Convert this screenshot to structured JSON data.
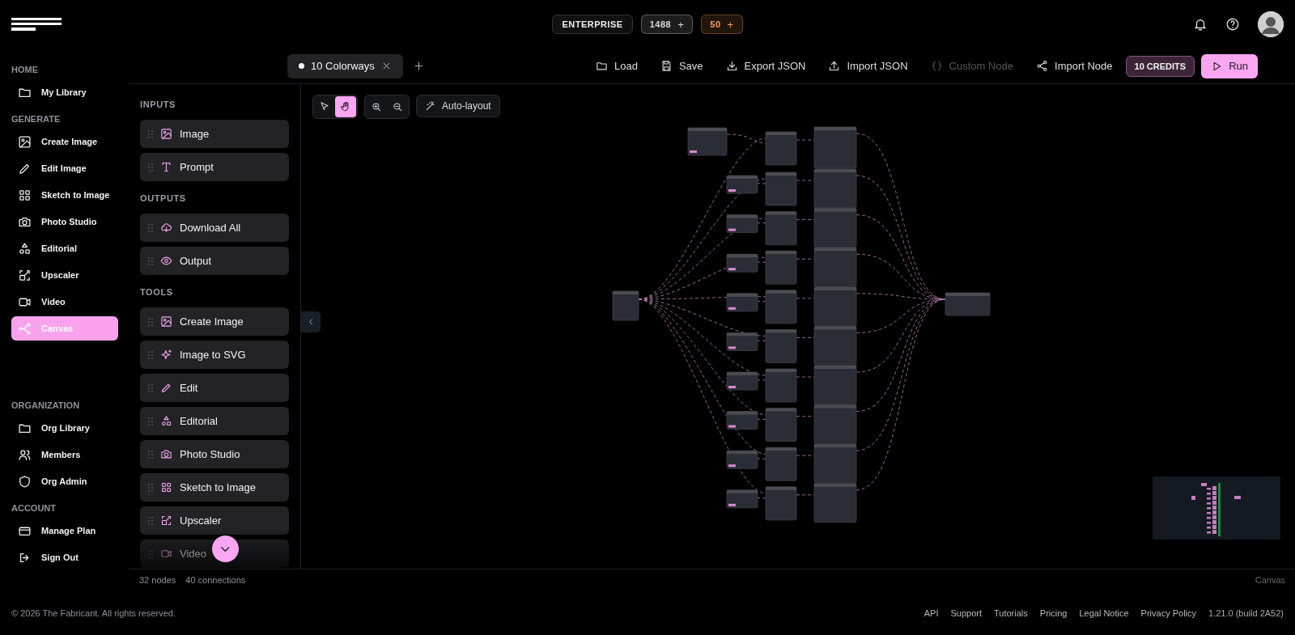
{
  "header": {
    "plan_badge": "ENTERPRISE",
    "credit_badges": [
      {
        "value": "1488",
        "plus": "+",
        "color": "#d8d8d8"
      },
      {
        "value": "50",
        "plus": "+",
        "color": "#f5a05a"
      }
    ]
  },
  "sidebar": {
    "sections": [
      {
        "title": "HOME",
        "items": [
          {
            "label": "My Library",
            "selected": false
          }
        ]
      },
      {
        "title": "GENERATE",
        "items": [
          {
            "label": "Create Image",
            "selected": false
          },
          {
            "label": "Edit Image",
            "selected": false
          },
          {
            "label": "Sketch to Image",
            "selected": false
          },
          {
            "label": "Photo Studio",
            "selected": false
          },
          {
            "label": "Editorial",
            "selected": false
          },
          {
            "label": "Upscaler",
            "selected": false
          },
          {
            "label": "Video",
            "selected": false
          },
          {
            "label": "Canvas",
            "selected": true
          }
        ]
      },
      {
        "title": "ORGANIZATION",
        "items": [
          {
            "label": "Org Library",
            "selected": false
          },
          {
            "label": "Members",
            "selected": false
          },
          {
            "label": "Org Admin",
            "selected": false
          }
        ]
      },
      {
        "title": "ACCOUNT",
        "items": [
          {
            "label": "Manage Plan",
            "selected": false
          },
          {
            "label": "Sign Out",
            "selected": false
          }
        ]
      }
    ]
  },
  "tabs": [
    {
      "label": "10 Colorways",
      "selected": true,
      "modified": true
    }
  ],
  "toolbar": {
    "actions": [
      {
        "label": "Load",
        "disabled": false
      },
      {
        "label": "Save",
        "disabled": false
      },
      {
        "label": "Export JSON",
        "disabled": false
      },
      {
        "label": "Import JSON",
        "disabled": false
      },
      {
        "label": "Custom Node",
        "disabled": true
      },
      {
        "label": "Import Node",
        "disabled": false
      }
    ],
    "credits": "10 CREDITS",
    "run": "Run"
  },
  "palette": {
    "sections": [
      {
        "title": "INPUTS",
        "items": [
          "Image",
          "Prompt"
        ]
      },
      {
        "title": "OUTPUTS",
        "items": [
          "Download All",
          "Output"
        ]
      },
      {
        "title": "TOOLS",
        "items": [
          "Create Image",
          "Image to SVG",
          "Edit",
          "Editorial",
          "Photo Studio",
          "Sketch to Image",
          "Upscaler",
          "Video"
        ]
      }
    ]
  },
  "canvas": {
    "tools": [
      {
        "selected": false
      },
      {
        "selected": true
      }
    ],
    "auto_layout": "Auto-layout"
  },
  "status_bar": {
    "nodes": "32 nodes",
    "connections": "40 connections",
    "mode": "Canvas"
  },
  "footer": {
    "copyright": "© 2026 The Fabricant. All rights reserved.",
    "links": [
      "API",
      "Support",
      "Tutorials",
      "Pricing",
      "Legal Notice",
      "Privacy Policy"
    ],
    "version": "1.21.0 (build 2A52)"
  }
}
